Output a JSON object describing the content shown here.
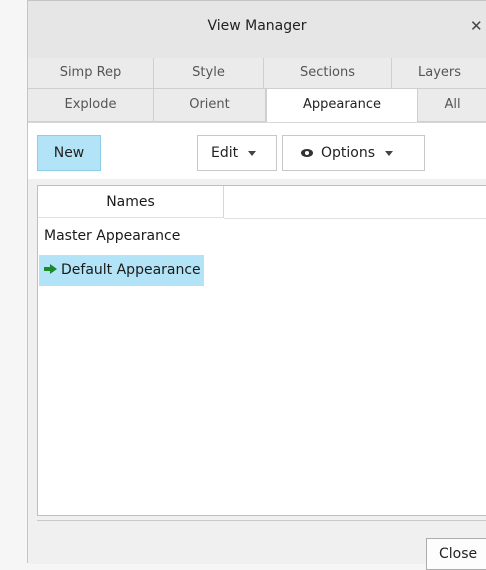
{
  "window": {
    "title": "View Manager",
    "close_glyph": "✕"
  },
  "tabs_row1": [
    {
      "label": "Simp Rep"
    },
    {
      "label": "Style"
    },
    {
      "label": "Sections"
    },
    {
      "label": "Layers"
    }
  ],
  "tabs_row2": [
    {
      "label": "Explode"
    },
    {
      "label": "Orient"
    },
    {
      "label": "Appearance",
      "active": true
    },
    {
      "label": "All"
    }
  ],
  "toolbar": {
    "new_label": "New",
    "edit_label": "Edit",
    "options_label": "Options"
  },
  "list": {
    "column_header": "Names",
    "items": [
      {
        "label": "Master Appearance",
        "selected": false
      },
      {
        "label": "Default Appearance",
        "selected": true,
        "active": true
      }
    ]
  },
  "footer": {
    "close_label": "Close"
  },
  "colors": {
    "selection": "#b3e3f6",
    "active_arrow": "#1b8a2a"
  }
}
